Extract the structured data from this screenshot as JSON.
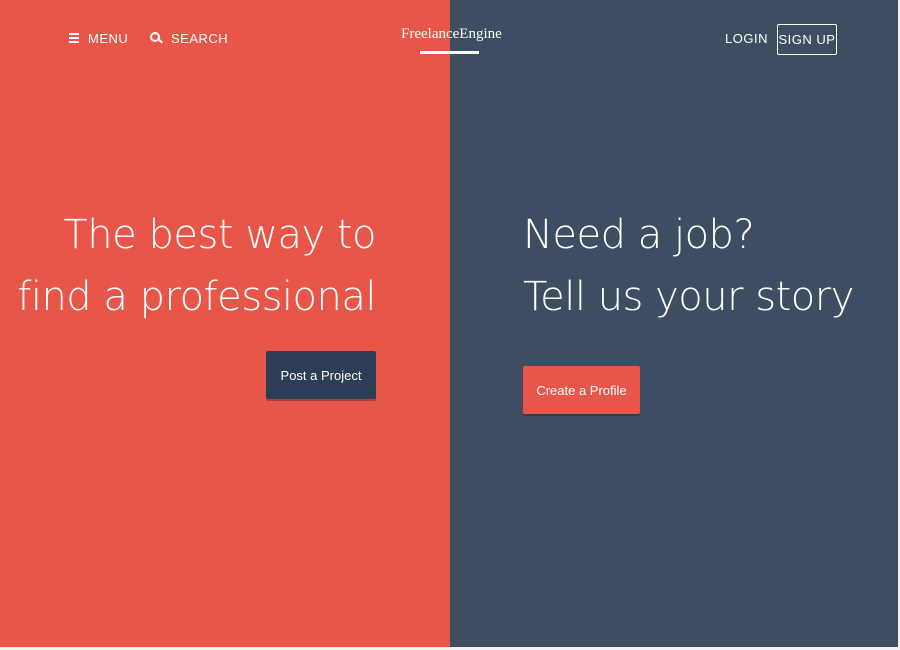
{
  "header": {
    "menu_label": "MENU",
    "search_label": "SEARCH",
    "logo_text": "FreelanceEngine",
    "login_label": "LOGIN",
    "signup_label": "SIGN UP"
  },
  "left_panel": {
    "headline_line1": "The best way to",
    "headline_line2": "find a professional",
    "cta_label": "Post a Project",
    "background_color": "#e8564a",
    "cta_color": "#2d3d55"
  },
  "right_panel": {
    "headline_line1": "Need a job?",
    "headline_line2": "Tell us your story",
    "cta_label": "Create a Profile",
    "background_color": "#3e4d62",
    "cta_color": "#e8564a"
  },
  "icons": {
    "menu": "hamburger-icon",
    "search": "search-icon"
  }
}
